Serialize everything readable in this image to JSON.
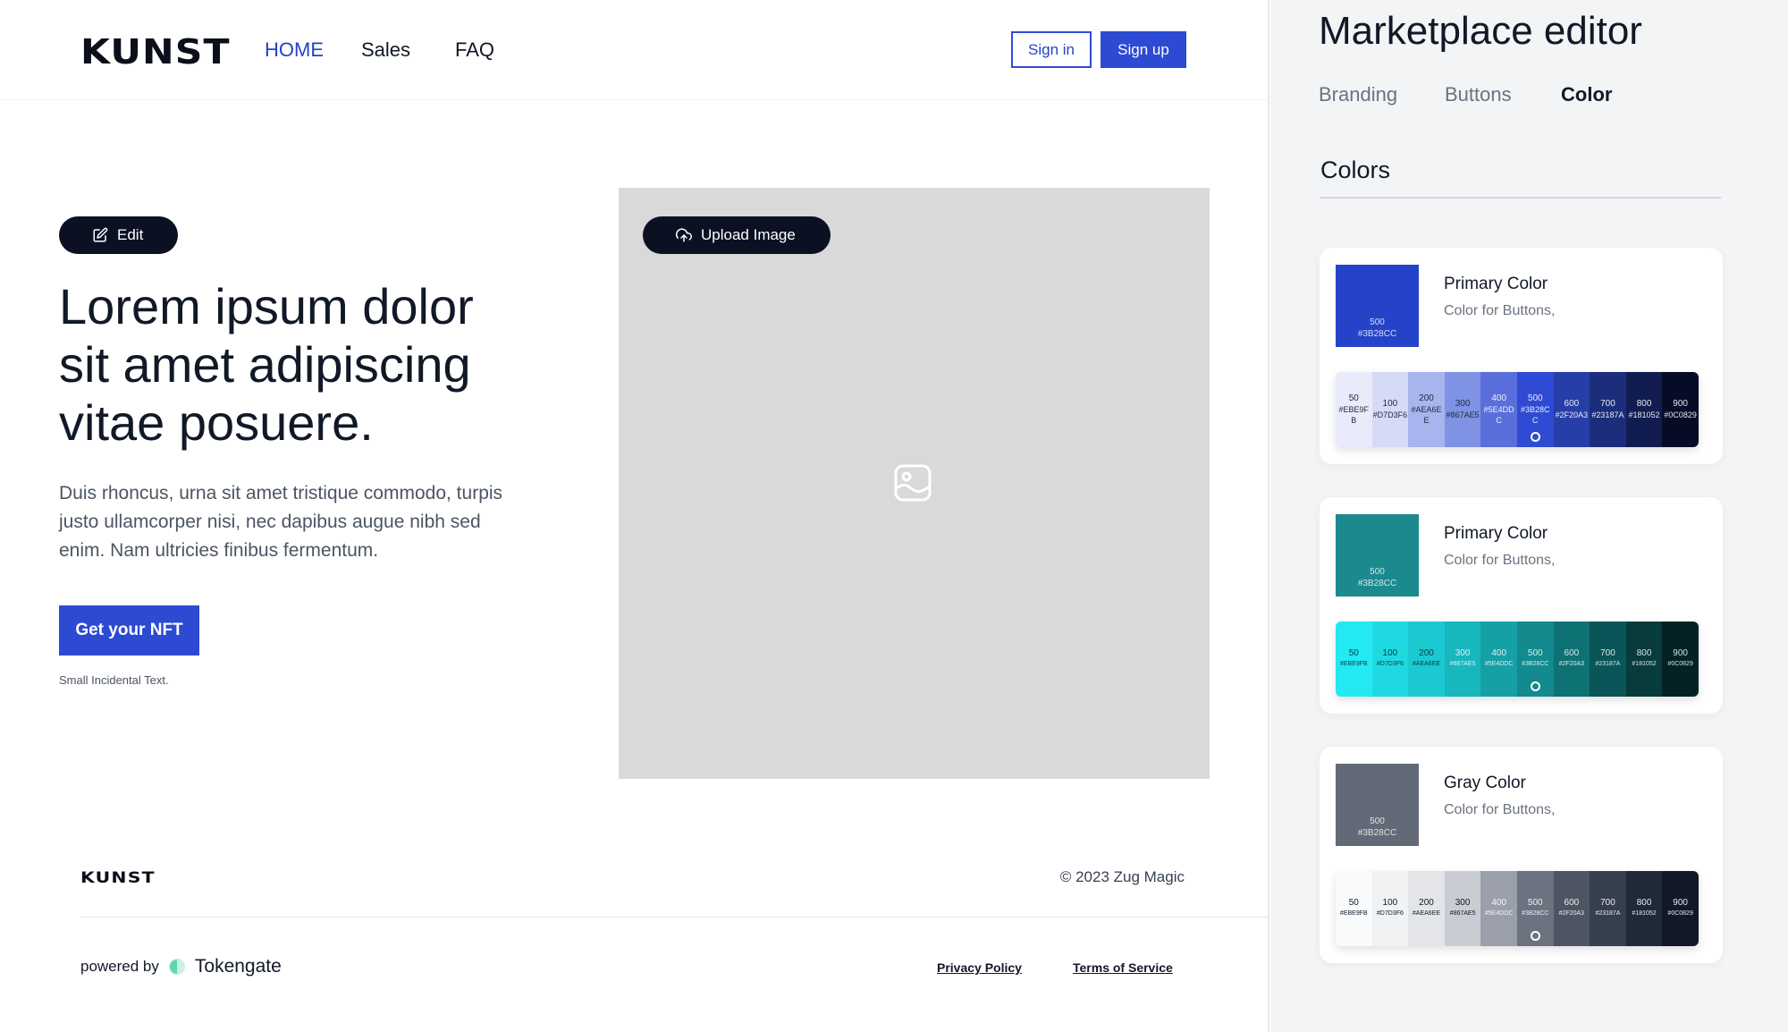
{
  "header": {
    "logo": "KUNST",
    "nav": [
      "HOME",
      "Sales",
      "FAQ"
    ],
    "sign_in": "Sign in",
    "sign_up": "Sign up"
  },
  "hero": {
    "edit_label": "Edit",
    "upload_label": "Upload Image",
    "title": "Lorem ipsum dolor sit amet adipiscing vitae posuere.",
    "body": "Duis rhoncus, urna sit amet tristique commodo, turpis justo ullamcorper nisi, nec dapibus augue nibh sed enim. Nam ultricies finibus fermentum.",
    "cta": "Get your NFT",
    "small_text": "Small Incidental Text.",
    "image_icon": "image-icon"
  },
  "footer": {
    "logo": "KUNST",
    "copyright": "© 2023 Zug Magic",
    "powered_by": "powered by",
    "provider": "Tokengate",
    "privacy": "Privacy Policy",
    "terms": "Terms of Service"
  },
  "editor": {
    "title": "Marketplace editor",
    "tabs": [
      "Branding",
      "Buttons",
      "Color"
    ],
    "active_tab": "Color",
    "section_title": "Colors",
    "cards": [
      {
        "title": "Primary Color",
        "subtitle": "Color for Buttons,",
        "swatch_weight": "500",
        "swatch_hex": "#3B28CC",
        "swatch_color": "#2543c9",
        "selected_index": 5,
        "scale": [
          {
            "w": "50",
            "hex": "#EBE9FB",
            "color": "#e9ebfb"
          },
          {
            "w": "100",
            "hex": "#D7D3F6",
            "color": "#d5daf6"
          },
          {
            "w": "200",
            "hex": "#AEA6EE",
            "color": "#a7b4ee"
          },
          {
            "w": "300",
            "hex": "#867AE5",
            "color": "#7f92e4"
          },
          {
            "w": "400",
            "hex": "#5E4DDC",
            "color": "#5a6fdb"
          },
          {
            "w": "500",
            "hex": "#3B28CC",
            "color": "#2f4bd3"
          },
          {
            "w": "600",
            "hex": "#2F20A3",
            "color": "#263ea8"
          },
          {
            "w": "700",
            "hex": "#23187A",
            "color": "#1c2d7c"
          },
          {
            "w": "800",
            "hex": "#181052",
            "color": "#111d51"
          },
          {
            "w": "900",
            "hex": "#0C0829",
            "color": "#060c26"
          }
        ]
      },
      {
        "title": "Primary Color",
        "subtitle": "Color for Buttons,",
        "swatch_weight": "500",
        "swatch_hex": "#3B28CC",
        "swatch_color": "#1b8a8e",
        "selected_index": 5,
        "scale": [
          {
            "w": "50",
            "hex": "#EBE9FB",
            "color": "#23e9f2"
          },
          {
            "w": "100",
            "hex": "#D7D3F6",
            "color": "#1fd9e2"
          },
          {
            "w": "200",
            "hex": "#AEA6EE",
            "color": "#1bc9d1"
          },
          {
            "w": "300",
            "hex": "#867AE5",
            "color": "#18b6bd"
          },
          {
            "w": "400",
            "hex": "#5E4DDC",
            "color": "#15a0a6"
          },
          {
            "w": "500",
            "hex": "#3B28CC",
            "color": "#128a8e"
          },
          {
            "w": "600",
            "hex": "#2F20A3",
            "color": "#0e7174"
          },
          {
            "w": "700",
            "hex": "#23187A",
            "color": "#0a5557"
          },
          {
            "w": "800",
            "hex": "#181052",
            "color": "#073b3c"
          },
          {
            "w": "900",
            "hex": "#0C0829",
            "color": "#042223"
          }
        ]
      },
      {
        "title": "Gray Color",
        "subtitle": "Color for Buttons,",
        "swatch_weight": "500",
        "swatch_hex": "#3B28CC",
        "swatch_color": "#636a77",
        "selected_index": 5,
        "scale": [
          {
            "w": "50",
            "hex": "#EBE9FB",
            "color": "#f9fafb"
          },
          {
            "w": "100",
            "hex": "#D7D3F6",
            "color": "#f1f2f4"
          },
          {
            "w": "200",
            "hex": "#AEA6EE",
            "color": "#e3e5e8"
          },
          {
            "w": "300",
            "hex": "#867AE5",
            "color": "#c9ccd3"
          },
          {
            "w": "400",
            "hex": "#5E4DDC",
            "color": "#9a9fab"
          },
          {
            "w": "500",
            "hex": "#3B28CC",
            "color": "#6b7280"
          },
          {
            "w": "600",
            "hex": "#2F20A3",
            "color": "#4d5562"
          },
          {
            "w": "700",
            "hex": "#23187A",
            "color": "#363f4d"
          },
          {
            "w": "800",
            "hex": "#181052",
            "color": "#1f2937"
          },
          {
            "w": "900",
            "hex": "#0C0829",
            "color": "#111827"
          }
        ]
      }
    ]
  },
  "colors": {
    "brand_blue": "#2d4ad3",
    "pill_dark": "#0b1023",
    "image_placeholder": "#d9d9d9",
    "tokengate_accent": "#5fd3b3"
  }
}
